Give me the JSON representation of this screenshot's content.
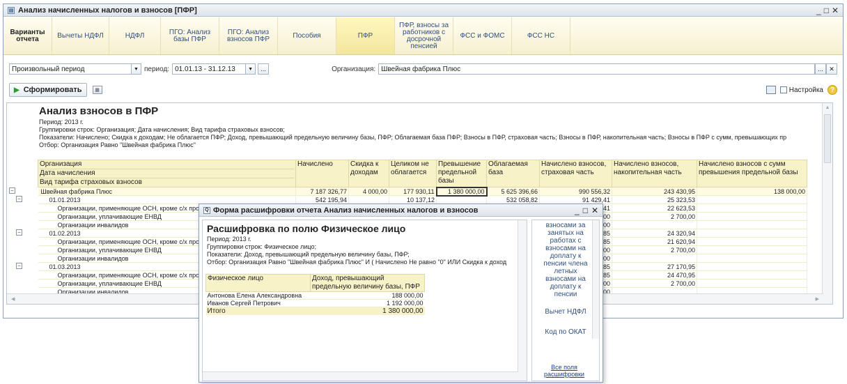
{
  "window": {
    "title": "Анализ начисленных налогов и взносов [ПФР]",
    "controls": [
      "_",
      "□",
      "✕"
    ]
  },
  "tabs": [
    {
      "label": "Варианты отчета"
    },
    {
      "label": "Вычеты НДФЛ"
    },
    {
      "label": "НДФЛ"
    },
    {
      "label": "ПГО: Анализ базы ПФР"
    },
    {
      "label": "ПГО: Анализ взносов ПФР"
    },
    {
      "label": "Пособия"
    },
    {
      "label": "ПФР"
    },
    {
      "label": "ПФР, взносы за работников с досрочной пенсией"
    },
    {
      "label": "ФСС и ФОМС"
    },
    {
      "label": "ФСС НС"
    }
  ],
  "params": {
    "period_type": "Произвольный период",
    "period_label": "период:",
    "period_value": "01.01.13 - 31.12.13",
    "ellipsis": "...",
    "org_label": "Организация:",
    "org_value": "Швейная фабрика Плюс",
    "clear": "...",
    "close": "✕"
  },
  "toolbar": {
    "generate": "Сформировать",
    "settings": "Настройка",
    "help": "?"
  },
  "report": {
    "title": "Анализ взносов в ПФР",
    "period": "Период: 2013 г.",
    "grouping": "Группировки строк: Организация; Дата начисления; Вид тарифа страховых взносов;",
    "indicators": "Показатели: Начислено; Скидка к доходам; Не облагается ПФР; Доход, превышающий предельную величину базы, ПФР; Облагаемая база ПФР; Взносы в ПФР, страховая часть; Взносы в ПФР, накопительная часть; Взносы в ПФР с сумм, превышающих пр",
    "filter": "Отбор: Организация Равно \"Швейная фабрика Плюс\"",
    "header_rows": [
      "Организация",
      "Дата начисления",
      "Вид тарифа страховых взносов"
    ],
    "columns": [
      "Начислено",
      "Скидка к доходам",
      "Целиком не облагается",
      "Превышение предельной базы",
      "Облагаемая база",
      "Начислено взносов, страховая часть",
      "Начислено взносов, накопительная часть",
      "Начислено взносов с сумм превышения предельной базы"
    ],
    "rows": [
      {
        "label": "Швейная фабрика Плюс",
        "level": 0,
        "vals": [
          "7 187 326,77",
          "4 000,00",
          "177 930,11",
          "1 380 000,00",
          "5 625 396,66",
          "990 556,32",
          "243 430,95",
          "138 000,00"
        ]
      },
      {
        "label": "01.01.2013",
        "level": 1,
        "vals": [
          "542 195,94",
          "",
          "10 137,12",
          "",
          "532 058,82",
          "91 429,41",
          "25 323,53",
          ""
        ]
      },
      {
        "label": "Организации, применяющие ОСН, кроме с/х про",
        "level": 2,
        "vals": [
          "",
          "",
          "",
          "",
          "",
          "77 929,41",
          "22 623,53",
          ""
        ]
      },
      {
        "label": "Организации, уплачивающие ЕНВД",
        "level": 2,
        "vals": [
          "",
          "",
          "",
          "",
          "",
          "7 200,00",
          "2 700,00",
          ""
        ]
      },
      {
        "label": "Организации инвалидов",
        "level": 2,
        "vals": [
          "",
          "",
          "",
          "",
          "",
          "6 300,00",
          "",
          ""
        ]
      },
      {
        "label": "01.02.2013",
        "level": 1,
        "vals": [
          "",
          "",
          "",
          "",
          "",
          "88 755,85",
          "24 320,94",
          ""
        ]
      },
      {
        "label": "Организации, применяющие ОСН, кроме с/х про",
        "level": 2,
        "vals": [
          "",
          "",
          "",
          "",
          "",
          "75 255,85",
          "21 620,94",
          ""
        ]
      },
      {
        "label": "Организации, уплачивающие ЕНВД",
        "level": 2,
        "vals": [
          "",
          "",
          "",
          "",
          "",
          "7 200,00",
          "2 700,00",
          ""
        ]
      },
      {
        "label": "Организации инвалидов",
        "level": 2,
        "vals": [
          "",
          "",
          "",
          "",
          "",
          "6 300,00",
          "",
          ""
        ]
      },
      {
        "label": "01.03.2013",
        "level": 1,
        "vals": [
          "",
          "",
          "",
          "",
          "",
          "95 255,85",
          "27 170,95",
          ""
        ]
      },
      {
        "label": "Организации, применяющие ОСН, кроме с/х про",
        "level": 2,
        "vals": [
          "",
          "",
          "",
          "",
          "",
          "81 755,85",
          "24 470,95",
          ""
        ]
      },
      {
        "label": "Организации, уплачивающие ЕНВД",
        "level": 2,
        "vals": [
          "",
          "",
          "",
          "",
          "",
          "7 200,00",
          "2 700,00",
          ""
        ]
      },
      {
        "label": "Организации инвалидов",
        "level": 2,
        "vals": [
          "",
          "",
          "",
          "",
          "",
          "6 300,00",
          "",
          ""
        ]
      }
    ]
  },
  "dialog": {
    "title": "Форма расшифровки отчета Анализ начисленных налогов и взносов",
    "heading": "Расшифровка по полю Физическое лицо",
    "period": "Период: 2013 г.",
    "grouping": "Группировки строк: Физическое лицо;",
    "indicators": "Показатели: Доход, превышающий предельную величину базы, ПФР;",
    "filter": "Отбор: Организация Равно \"Швейная фабрика Плюс\" И ( Начислено Не равно \"0\" ИЛИ Скидка к доход",
    "col1": "Физическое лицо",
    "col2": "Доход, превышающий предельную величину базы, ПФР",
    "rows": [
      {
        "name": "Антонова Елена Александровна",
        "value": "188 000,00"
      },
      {
        "name": "Иванов Сергей Петрович",
        "value": "1 192 000,00"
      }
    ],
    "total_label": "Итого",
    "total_value": "1 380 000,00",
    "side_items": [
      "взносами за",
      "занятых на",
      "работах с",
      "взносами на",
      "доплату к",
      "пенсии члена",
      "летных",
      "взносами на",
      "доплату к",
      "пенсии",
      "Вычет НДФЛ",
      "Код по ОКАТ"
    ],
    "all_fields": "Все поля расшифровки"
  }
}
